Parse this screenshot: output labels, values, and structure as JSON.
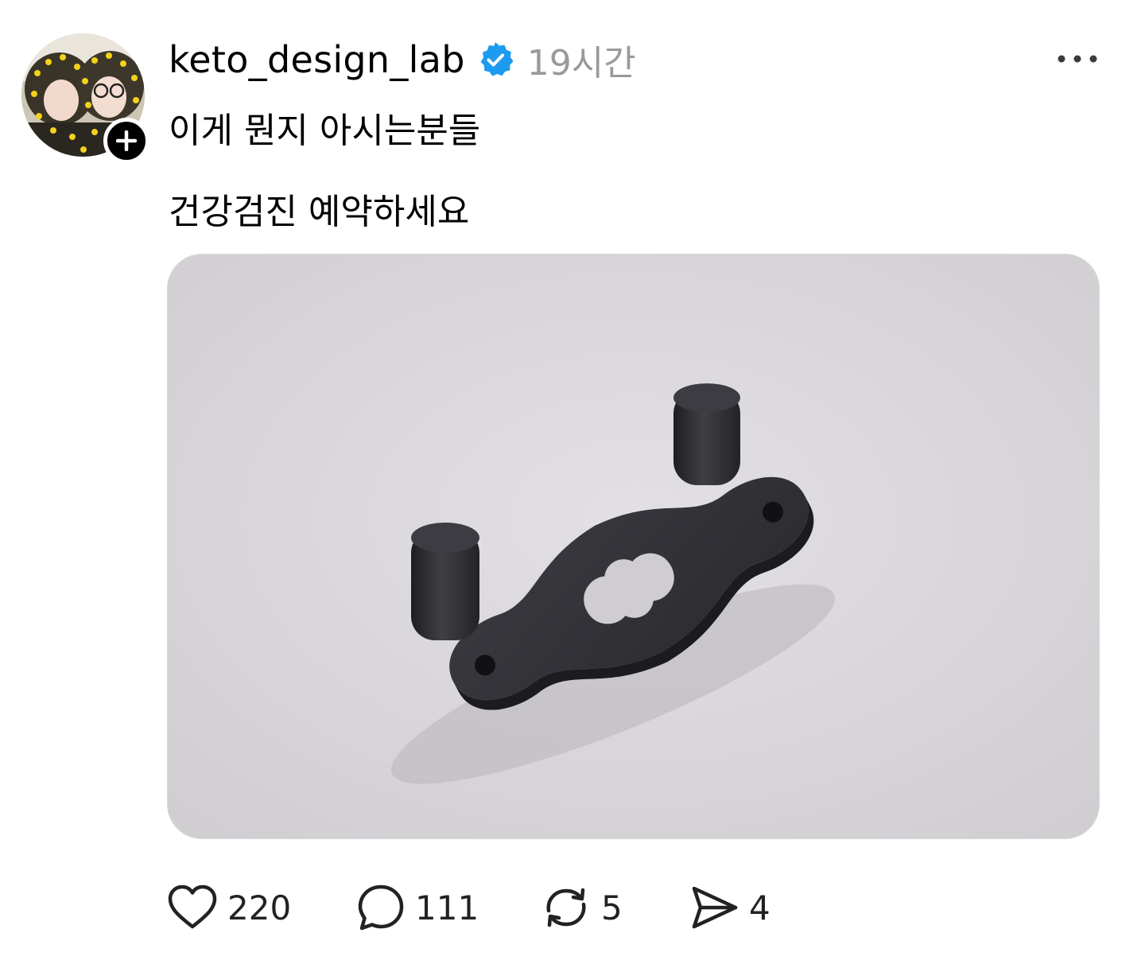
{
  "post": {
    "username": "keto_design_lab",
    "time": "19시간",
    "lines": [
      "이게 뭔지 아시는분들",
      "건강검진 예약하세요"
    ]
  },
  "actions": {
    "likes": "220",
    "replies": "111",
    "reposts": "5",
    "shares": "4"
  },
  "colors": {
    "verified": "#1d9bf0",
    "time_text": "#9a9a9a",
    "photo_bg": "#d9d7da"
  },
  "icons": [
    "plus-icon",
    "verified-badge-icon",
    "more-icon",
    "heart-icon",
    "comment-icon",
    "repost-icon",
    "share-icon"
  ]
}
